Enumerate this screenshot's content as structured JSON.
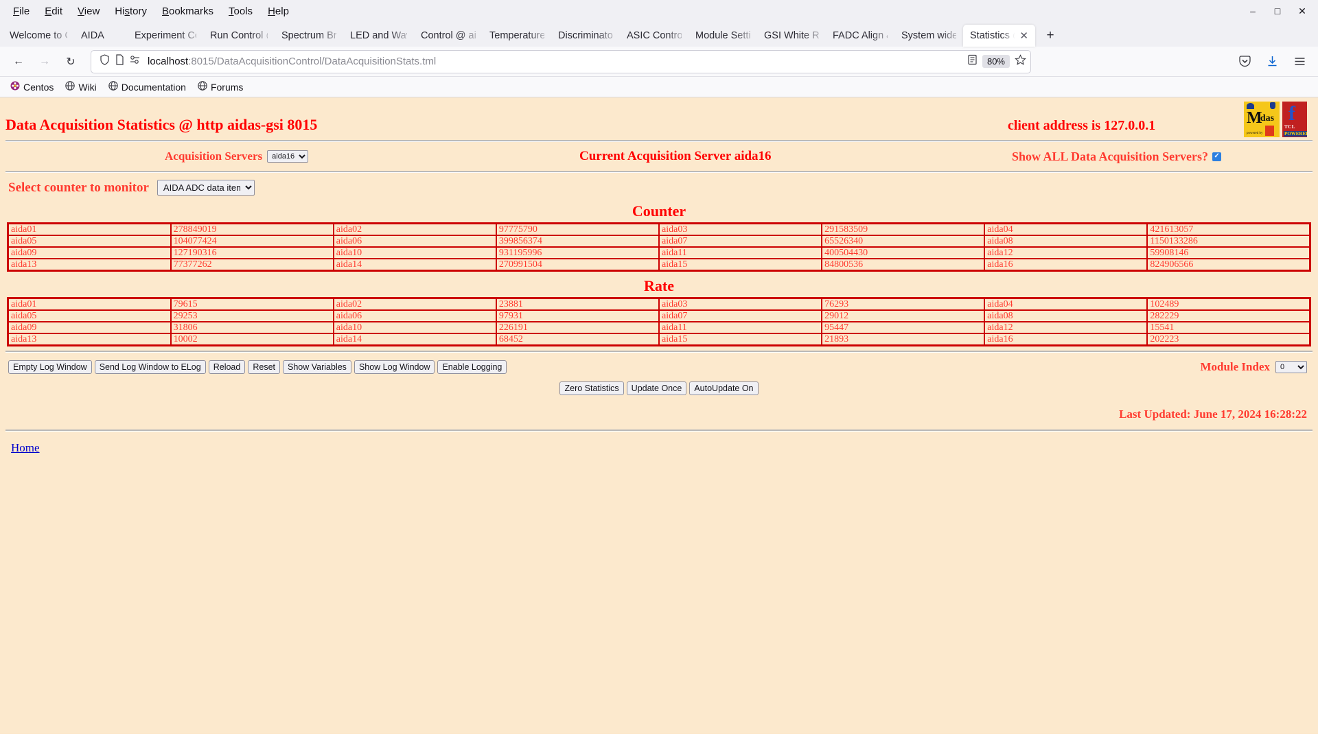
{
  "browser": {
    "menus": [
      "File",
      "Edit",
      "View",
      "History",
      "Bookmarks",
      "Tools",
      "Help"
    ],
    "window_controls": {
      "minimize": "–",
      "maximize": "□",
      "close": "✕"
    },
    "tabs": [
      {
        "label": "Welcome to CentOS",
        "active": false
      },
      {
        "label": "AIDA",
        "active": false
      },
      {
        "label": "Experiment Control",
        "active": false
      },
      {
        "label": "Run Control @ aidas",
        "active": false
      },
      {
        "label": "Spectrum Browser",
        "active": false
      },
      {
        "label": "LED and Waveform",
        "active": false
      },
      {
        "label": "Control @ aidas",
        "active": false
      },
      {
        "label": "Temperature and",
        "active": false
      },
      {
        "label": "Discriminator co",
        "active": false
      },
      {
        "label": "ASIC Control @",
        "active": false
      },
      {
        "label": "Module Settings",
        "active": false
      },
      {
        "label": "GSI White Rabbit",
        "active": false
      },
      {
        "label": "FADC Align & Co",
        "active": false
      },
      {
        "label": "System wide Ch",
        "active": false
      },
      {
        "label": "Statistics @ ai",
        "active": true
      }
    ],
    "new_tab_label": "+",
    "nav": {
      "back": "←",
      "forward": "→",
      "reload": "↻",
      "url_host": "localhost",
      "url_rest": ":8015/DataAcquisitionControl/DataAcquisitionStats.tml",
      "zoom_level": "80%"
    },
    "bookmarks": [
      {
        "label": "Centos",
        "icon": "centos-icon"
      },
      {
        "label": "Wiki",
        "icon": "globe-icon"
      },
      {
        "label": "Documentation",
        "icon": "globe-icon"
      },
      {
        "label": "Forums",
        "icon": "globe-icon"
      }
    ]
  },
  "page": {
    "title": "Data Acquisition Statistics @ http aidas-gsi 8015",
    "client_address": "client address is 127.0.0.1",
    "logos": {
      "midas": {
        "m": "M",
        "rest": "idas",
        "sub": "powered by"
      },
      "tcl": {
        "f": "f",
        "tcl": "TCL",
        "powered": "POWERED"
      }
    },
    "acquisition_servers_label": "Acquisition Servers",
    "acquisition_server_value": "aida16",
    "current_server": "Current Acquisition Server aida16",
    "show_all_label": "Show ALL Data Acquisition Servers?",
    "show_all_checked": true,
    "counter_select_label": "Select counter to monitor",
    "counter_select_value": "AIDA ADC data items",
    "counter_options": [
      "AIDA ADC data items"
    ],
    "counter_section_title": "Counter",
    "rate_section_title": "Rate",
    "counter_rows": [
      [
        [
          "aida01",
          "278849019"
        ],
        [
          "aida02",
          "97775790"
        ],
        [
          "aida03",
          "291583509"
        ],
        [
          "aida04",
          "421613057"
        ]
      ],
      [
        [
          "aida05",
          "104077424"
        ],
        [
          "aida06",
          "399856374"
        ],
        [
          "aida07",
          "65526340"
        ],
        [
          "aida08",
          "1150133286"
        ]
      ],
      [
        [
          "aida09",
          "127190316"
        ],
        [
          "aida10",
          "931195996"
        ],
        [
          "aida11",
          "400504430"
        ],
        [
          "aida12",
          "59908146"
        ]
      ],
      [
        [
          "aida13",
          "77377262"
        ],
        [
          "aida14",
          "270991504"
        ],
        [
          "aida15",
          "84800536"
        ],
        [
          "aida16",
          "824906566"
        ]
      ]
    ],
    "rate_rows": [
      [
        [
          "aida01",
          "79615"
        ],
        [
          "aida02",
          "23881"
        ],
        [
          "aida03",
          "76293"
        ],
        [
          "aida04",
          "102489"
        ]
      ],
      [
        [
          "aida05",
          "29253"
        ],
        [
          "aida06",
          "97931"
        ],
        [
          "aida07",
          "29012"
        ],
        [
          "aida08",
          "282229"
        ]
      ],
      [
        [
          "aida09",
          "31806"
        ],
        [
          "aida10",
          "226191"
        ],
        [
          "aida11",
          "95447"
        ],
        [
          "aida12",
          "15541"
        ]
      ],
      [
        [
          "aida13",
          "10002"
        ],
        [
          "aida14",
          "68452"
        ],
        [
          "aida15",
          "21893"
        ],
        [
          "aida16",
          "202223"
        ]
      ]
    ],
    "log_buttons": [
      "Empty Log Window",
      "Send Log Window to ELog",
      "Reload",
      "Reset",
      "Show Variables",
      "Show Log Window",
      "Enable Logging"
    ],
    "module_index_label": "Module Index",
    "module_index_value": "0",
    "module_index_options": [
      "0"
    ],
    "action_buttons": [
      "Zero Statistics",
      "Update Once",
      "AutoUpdate On"
    ],
    "last_updated": "Last Updated: June 17, 2024 16:28:22",
    "home_link": "Home"
  },
  "colors": {
    "page_bg": "#fce9cd",
    "accent_red": "#ff0000",
    "table_border": "#cc0000",
    "link_blue": "#0000cc"
  }
}
